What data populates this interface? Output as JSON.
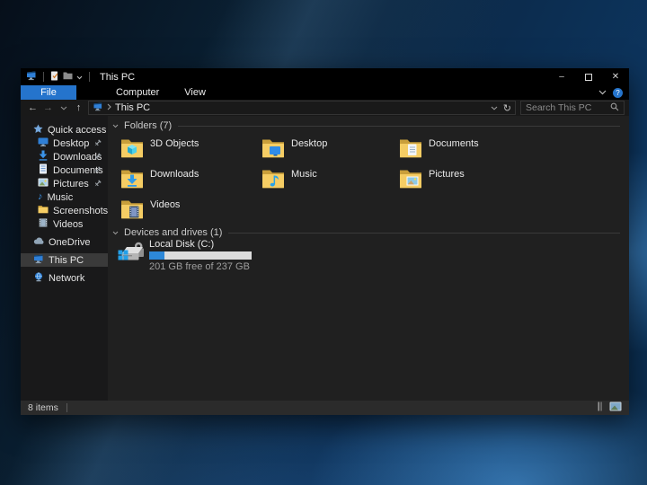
{
  "window": {
    "title": "This PC"
  },
  "titlebar": {
    "controls": {
      "minimize": "–",
      "close": "✕"
    }
  },
  "ribbon": {
    "tabs": [
      {
        "label": "File"
      },
      {
        "label": "Computer"
      },
      {
        "label": "View"
      }
    ],
    "help_glyph": "?"
  },
  "address": {
    "breadcrumb": "This PC",
    "search_placeholder": "Search This PC"
  },
  "sidebar": {
    "items": [
      {
        "label": "Quick access",
        "pinned": false
      },
      {
        "label": "Desktop",
        "pinned": true
      },
      {
        "label": "Downloads",
        "pinned": true
      },
      {
        "label": "Documents",
        "pinned": true
      },
      {
        "label": "Pictures",
        "pinned": true
      },
      {
        "label": "Music",
        "pinned": false
      },
      {
        "label": "Screenshots",
        "pinned": false
      },
      {
        "label": "Videos",
        "pinned": false
      },
      {
        "label": "OneDrive",
        "pinned": false
      },
      {
        "label": "This PC",
        "pinned": false,
        "selected": true
      },
      {
        "label": "Network",
        "pinned": false
      }
    ]
  },
  "main": {
    "sections": [
      {
        "label": "Folders (7)"
      },
      {
        "label": "Devices and drives (1)"
      }
    ],
    "folders": [
      {
        "name": "3D Objects"
      },
      {
        "name": "Desktop"
      },
      {
        "name": "Documents"
      },
      {
        "name": "Downloads"
      },
      {
        "name": "Music"
      },
      {
        "name": "Pictures"
      },
      {
        "name": "Videos"
      }
    ],
    "drive": {
      "name": "Local Disk (C:)",
      "free_text": "201 GB free of 237 GB",
      "used_percent": 15
    }
  },
  "statusbar": {
    "items_count": "8 items"
  },
  "colors": {
    "accent_blue": "#2574cc",
    "progress_fill": "#2d88d8",
    "folder_front": "#f5cd64",
    "folder_back": "#c99f3b",
    "selection_gray": "#3a3a3a"
  }
}
